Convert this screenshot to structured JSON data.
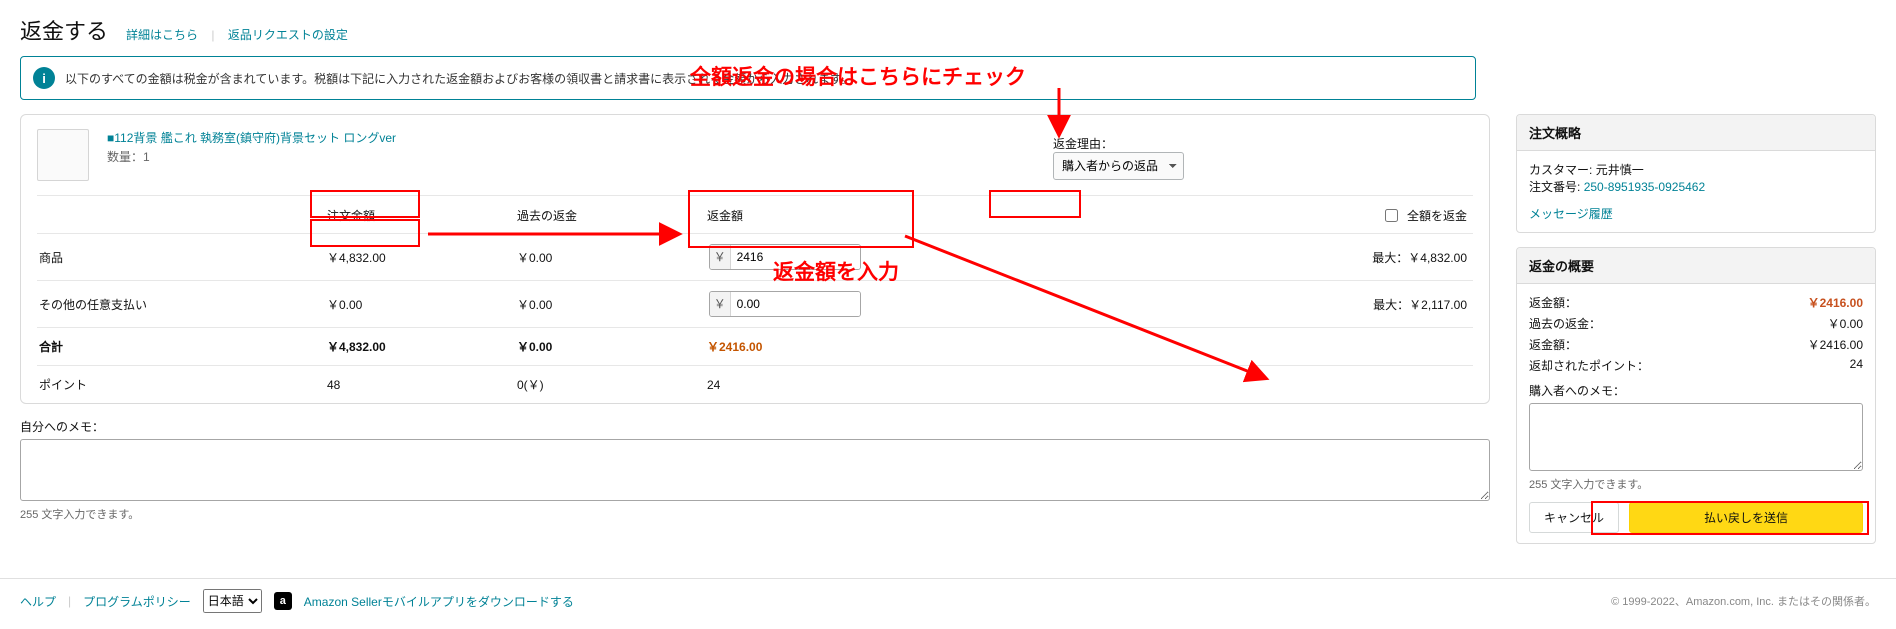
{
  "header": {
    "title": "返金する",
    "detail_link": "詳細はこちら",
    "settings_link": "返品リクエストの設定"
  },
  "banner": {
    "message": "以下のすべての金額は税金が含まれています。税額は下記に入力された返金額およびお客様の領収書と請求書に表示される金額から入力されます。"
  },
  "annotations": {
    "full_refund": "全額返金の場合はこちらにチェック",
    "enter_amount": "返金額を入力"
  },
  "product": {
    "title": "■112背景 艦これ 執務室(鎮守府)背景セット ロングver",
    "qty_label": "数量：",
    "qty": "1"
  },
  "reason": {
    "label": "返金理由：",
    "selected": "購入者からの返品"
  },
  "columns": {
    "label": "",
    "order_amount": "注文金額",
    "past_refund": "過去の返金",
    "refund_amount": "返金額",
    "full_refund_label": "全額を返金"
  },
  "rows": {
    "product": {
      "label": "商品",
      "order_amount": "￥4,832.00",
      "past_refund": "￥0.00",
      "refund_input": "2416",
      "max": "最大：￥4,832.00"
    },
    "other": {
      "label": "その他の任意支払い",
      "order_amount": "￥0.00",
      "past_refund": "￥0.00",
      "refund_input": "0.00",
      "max": "最大：￥2,117.00"
    },
    "total": {
      "label": "合計",
      "order_amount": "￥4,832.00",
      "past_refund": "￥0.00",
      "refund_amount": "￥2416.00"
    },
    "points": {
      "label": "ポイント",
      "order_amount": "48",
      "past_refund": "0(￥)",
      "refund_amount": "24"
    }
  },
  "memo": {
    "label": "自分へのメモ：",
    "hint": "255 文字入力できます。"
  },
  "summary_panel": {
    "title": "注文概略",
    "customer_label": "カスタマー:",
    "customer_name": "元井慎一",
    "order_label": "注文番号:",
    "order_id": "250-8951935-0925462",
    "msg_history": "メッセージ履歴"
  },
  "refund_panel": {
    "title": "返金の概要",
    "rows": {
      "refund_amount": {
        "label": "返金額：",
        "value": "￥2416.00"
      },
      "past": {
        "label": "過去の返金：",
        "value": "￥0.00"
      },
      "refund": {
        "label": "返金額：",
        "value": "￥2416.00"
      },
      "points": {
        "label": "返却されたポイント：",
        "value": "24"
      }
    },
    "buyer_memo_label": "購入者へのメモ：",
    "buyer_memo_hint": "255 文字入力できます。",
    "cancel": "キャンセル",
    "submit": "払い戻しを送信"
  },
  "footer": {
    "help": "ヘルプ",
    "policy": "プログラムポリシー",
    "lang": "日本語",
    "app_text": "Amazon Sellerモバイルアプリをダウンロードする",
    "copyright": "© 1999-2022、Amazon.com, Inc. またはその関係者。"
  }
}
